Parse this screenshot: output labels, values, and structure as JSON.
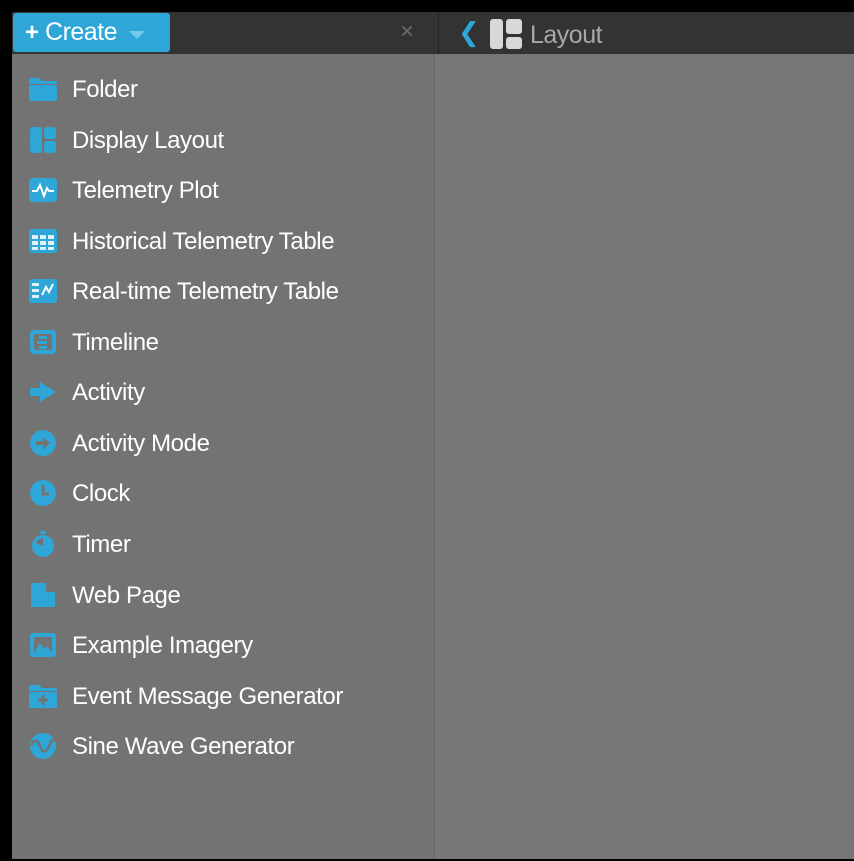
{
  "header": {
    "create_label": "Create",
    "close_label": "×",
    "back_glyph": "❮",
    "title": "Layout"
  },
  "menu": {
    "items": [
      {
        "label": "Folder",
        "icon": "folder-icon"
      },
      {
        "label": "Display Layout",
        "icon": "display-layout-icon"
      },
      {
        "label": "Telemetry Plot",
        "icon": "telemetry-plot-icon"
      },
      {
        "label": "Historical Telemetry Table",
        "icon": "historical-table-icon"
      },
      {
        "label": "Real-time Telemetry Table",
        "icon": "realtime-table-icon"
      },
      {
        "label": "Timeline",
        "icon": "timeline-icon"
      },
      {
        "label": "Activity",
        "icon": "activity-icon"
      },
      {
        "label": "Activity Mode",
        "icon": "activity-mode-icon"
      },
      {
        "label": "Clock",
        "icon": "clock-icon"
      },
      {
        "label": "Timer",
        "icon": "timer-icon"
      },
      {
        "label": "Web Page",
        "icon": "web-page-icon"
      },
      {
        "label": "Example Imagery",
        "icon": "imagery-icon"
      },
      {
        "label": "Event Message Generator",
        "icon": "event-generator-icon"
      },
      {
        "label": "Sine Wave Generator",
        "icon": "sine-wave-icon"
      }
    ]
  },
  "colors": {
    "accent": "#2ea6d8",
    "topbar": "#333333",
    "panel": "#737373",
    "content": "#777777",
    "text": "#ffffff",
    "muted_text": "#a8a8a8"
  }
}
